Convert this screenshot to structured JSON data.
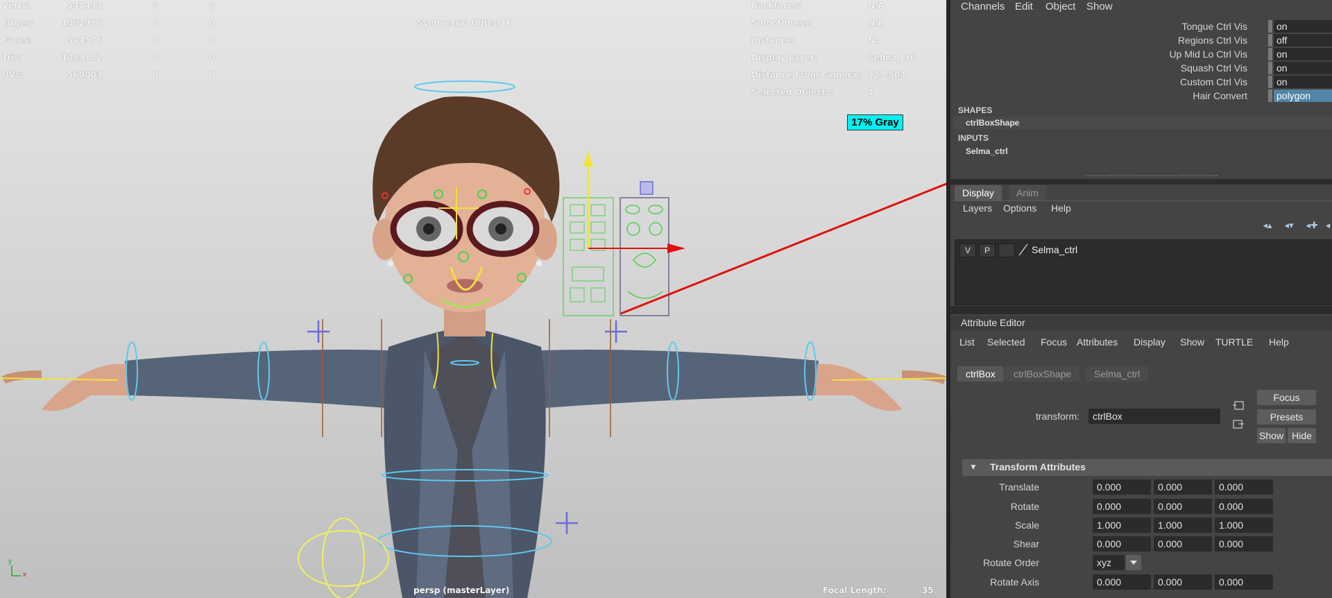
{
  "viewport": {
    "stats": [
      {
        "label": "Verts:",
        "v1": "548433",
        "v2": "0",
        "v3": "0"
      },
      {
        "label": "Edges:",
        "v1": "1092936",
        "v2": "0",
        "v3": "0"
      },
      {
        "label": "Faces:",
        "v1": "544576",
        "v2": "0",
        "v3": "0"
      },
      {
        "label": "Tris:",
        "v1": "1089152",
        "v2": "0",
        "v3": "0"
      },
      {
        "label": "UVs:",
        "v1": "560003",
        "v2": "0",
        "v3": "0"
      }
    ],
    "symmetry": "Symmetry: Object X",
    "info": [
      {
        "label": "Backfaces:",
        "value": "N/A"
      },
      {
        "label": "Smoothness:",
        "value": "N/A"
      },
      {
        "label": "Instance:",
        "value": "No"
      },
      {
        "label": "Display Layer:",
        "value": "Selma_ctrl"
      },
      {
        "label": "Distance From Camera:",
        "value": "127.504"
      },
      {
        "label": "Selected Objects:",
        "value": "1"
      }
    ],
    "gray_swatch": "17% Gray",
    "camera_label": "persp (masterLayer)",
    "focal_label": "Focal Length:",
    "focal_value": "35",
    "axis_y": "y",
    "axis_x": "x"
  },
  "channel_box": {
    "menus": [
      "Channels",
      "Edit",
      "Object",
      "Show"
    ],
    "rows": [
      {
        "label": "Tongue Ctrl Vis",
        "value": "on"
      },
      {
        "label": "Regions Ctrl Vis",
        "value": "off"
      },
      {
        "label": "Up Mid Lo Ctrl Vis",
        "value": "on"
      },
      {
        "label": "Squash Ctrl Vis",
        "value": "on"
      },
      {
        "label": "Custom Ctrl Vis",
        "value": "on"
      },
      {
        "label": "Hair Convert",
        "value": "polygon"
      }
    ],
    "shapes_title": "SHAPES",
    "shape_item": "ctrlBoxShape",
    "inputs_title": "INPUTS",
    "input_item": "Selma_ctrl"
  },
  "layer_editor": {
    "tabs": [
      "Display",
      "Anim"
    ],
    "menus": [
      "Layers",
      "Options",
      "Help"
    ],
    "layer": {
      "v": "V",
      "p": "P",
      "name": "Selma_ctrl"
    }
  },
  "attribute_editor": {
    "title": "Attribute Editor",
    "menus": [
      "List",
      "Selected",
      "Focus",
      "Attributes",
      "Display",
      "Show",
      "TURTLE",
      "Help"
    ],
    "tabs": [
      "ctrlBox",
      "ctrlBoxShape",
      "Selma_ctrl"
    ],
    "transform_label": "transform:",
    "transform_value": "ctrlBox",
    "buttons": {
      "focus": "Focus",
      "presets": "Presets",
      "show": "Show",
      "hide": "Hide"
    },
    "section_title": "Transform Attributes",
    "attrs": [
      {
        "label": "Translate",
        "values": [
          "0.000",
          "0.000",
          "0.000"
        ]
      },
      {
        "label": "Rotate",
        "values": [
          "0.000",
          "0.000",
          "0.000"
        ]
      },
      {
        "label": "Scale",
        "values": [
          "1.000",
          "1.000",
          "1.000"
        ]
      },
      {
        "label": "Shear",
        "values": [
          "0.000",
          "0.000",
          "0.000"
        ]
      }
    ],
    "rotate_order_label": "Rotate Order",
    "rotate_order_value": "xyz",
    "rotate_axis_label": "Rotate Axis",
    "rotate_axis_values": [
      "0.000",
      "0.000",
      "0.000"
    ]
  },
  "colors": {
    "annotation_arrow": "#e01010",
    "gray_swatch": "#00f2f2",
    "selected_value": "#5285a6"
  }
}
